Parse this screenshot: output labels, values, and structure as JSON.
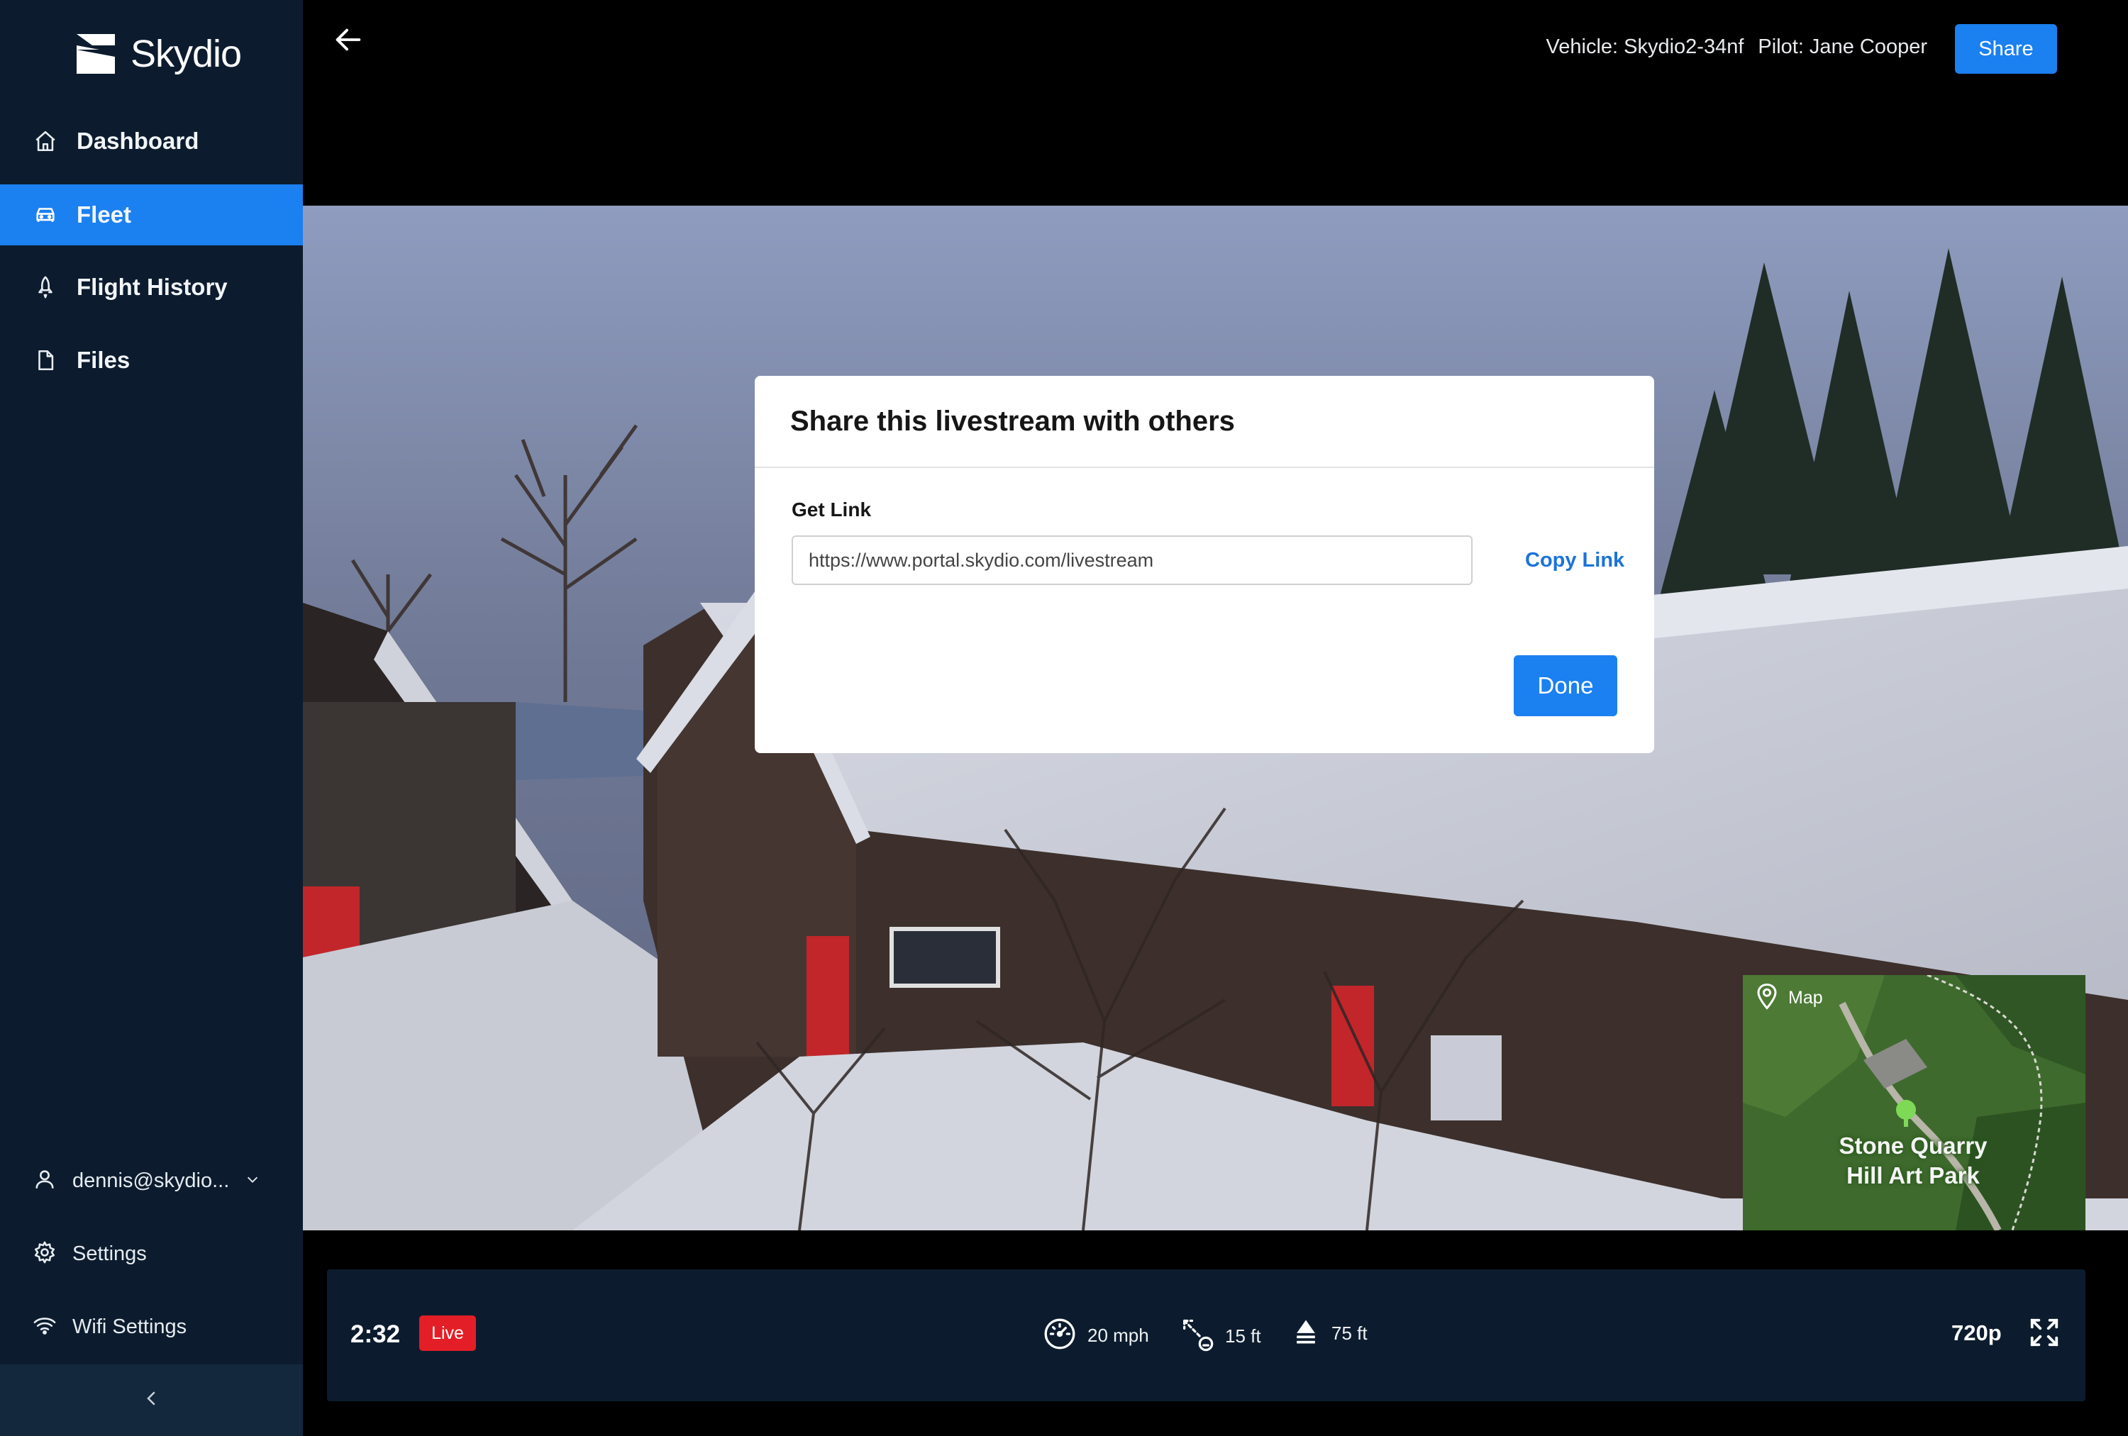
{
  "app": {
    "brand": "Skydio"
  },
  "sidebar": {
    "items": [
      {
        "label": "Dashboard",
        "icon": "home-icon",
        "active": false
      },
      {
        "label": "Fleet",
        "icon": "vehicle-icon",
        "active": true
      },
      {
        "label": "Flight History",
        "icon": "rocket-icon",
        "active": false
      },
      {
        "label": "Files",
        "icon": "file-icon",
        "active": false
      }
    ],
    "user": {
      "label": "dennis@skydio...",
      "icon": "user-icon"
    },
    "settings": {
      "label": "Settings",
      "icon": "gear-icon"
    },
    "wifi": {
      "label": "Wifi Settings",
      "icon": "wifi-icon"
    },
    "accent_color": "#1b80f0",
    "background_color": "#0c1c2e"
  },
  "header": {
    "vehicle": "Vehicle: Skydio2-34nf",
    "pilot": "Pilot: Jane Cooper",
    "share_label": "Share"
  },
  "modal": {
    "title": "Share this livestream with others",
    "link_label": "Get Link",
    "link_value": "https://www.portal.skydio.com/livestream",
    "copy_label": "Copy Link",
    "done_label": "Done"
  },
  "map": {
    "label": "Map",
    "place_line1": "Stone Quarry",
    "place_line2": "Hill Art Park"
  },
  "controls": {
    "elapsed": "2:32",
    "live_label": "Live",
    "live_color": "#e41e26",
    "speed": "20 mph",
    "distance": "15 ft",
    "altitude": "75 ft",
    "resolution": "720p"
  }
}
